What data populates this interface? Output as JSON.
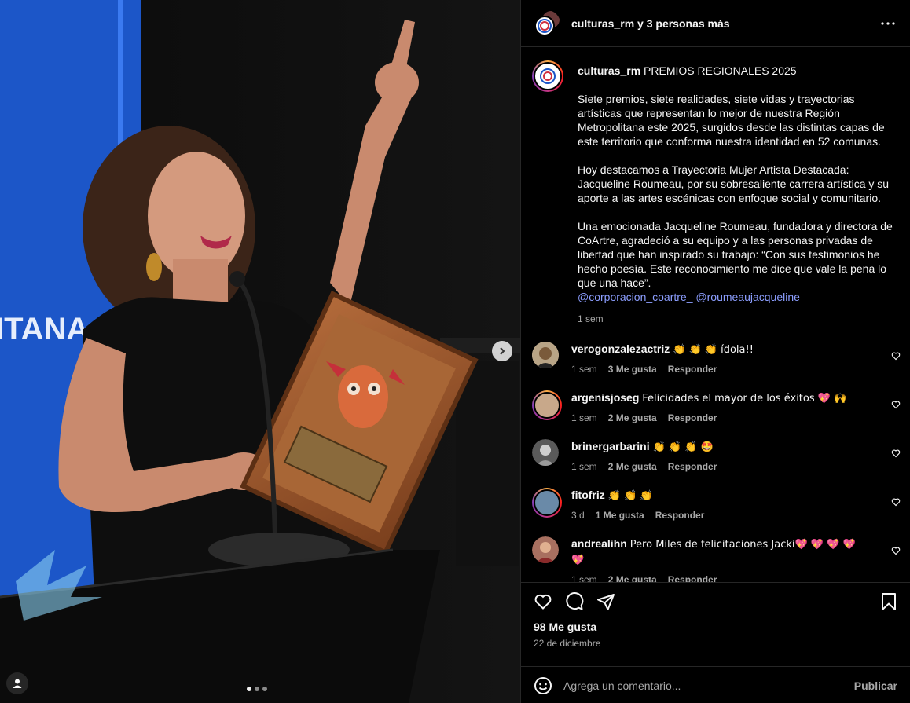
{
  "header": {
    "username": "culturas_rm",
    "collab_suffix": "y 3 personas más"
  },
  "caption": {
    "username": "culturas_rm",
    "headline": "PREMIOS REGIONALES 2025",
    "paragraph_1": "Siete premios, siete realidades, siete vidas y trayectorias artísticas que representan lo mejor de nuestra Región Metropolitana este 2025, surgidos desde las distintas capas de este territorio que conforma nuestra identidad en 52 comunas.",
    "paragraph_2": "Hoy destacamos a Trayectoria Mujer Artista Destacada: Jacqueline Roumeau, por su sobresaliente carrera artística y su aporte a las artes escénicas con enfoque social y comunitario.",
    "paragraph_3": "Una emocionada Jacqueline Roumeau, fundadora y directora de CoArtre, agradeció a su equipo y a las personas privadas de libertad que han inspirado su trabajo: “Con sus testimonios he hecho poesía. Este reconocimiento me dice que vale la pena lo que una hace”.",
    "mention_1": "@corporacion_coartre_",
    "mention_2": "@roumeaujacqueline",
    "time": "1 sem"
  },
  "comments": [
    {
      "username": "verogonzalezactriz",
      "text": "👏 👏 👏 ídola!!",
      "time": "1 sem",
      "likes": "3 Me gusta",
      "reply": "Responder"
    },
    {
      "username": "argenisjoseg",
      "text": "Felicidades el mayor de los éxitos 💖 🙌",
      "time": "1 sem",
      "likes": "2 Me gusta",
      "reply": "Responder"
    },
    {
      "username": "brinergarbarini",
      "text": "👏 👏 👏 🤩",
      "time": "1 sem",
      "likes": "2 Me gusta",
      "reply": "Responder"
    },
    {
      "username": "fitofriz",
      "text": "👏 👏 👏",
      "time": "3 d",
      "likes": "1 Me gusta",
      "reply": "Responder"
    },
    {
      "username": "andrealihn",
      "text": "Pero Miles de felicitaciones Jacki💖 💖 💖 💖 💖",
      "time": "1 sem",
      "likes": "2 Me gusta",
      "reply": "Responder"
    }
  ],
  "engagement": {
    "likes": "98 Me gusta",
    "date": "22 de diciembre"
  },
  "composer": {
    "placeholder": "Agrega un comentario...",
    "post_label": "Publicar"
  },
  "photo": {
    "banner_text": "ITANA",
    "carousel_index": 1,
    "carousel_count": 3
  },
  "icons": [
    "more-icon",
    "heart-icon",
    "comment-icon",
    "share-icon",
    "save-icon",
    "emoji-icon",
    "next-arrow-icon",
    "user-tag-icon"
  ],
  "colors": {
    "background": "#000000",
    "mention": "#8c9eff",
    "muted": "#a8a8a8",
    "banner_blue": "#1c56c8"
  }
}
